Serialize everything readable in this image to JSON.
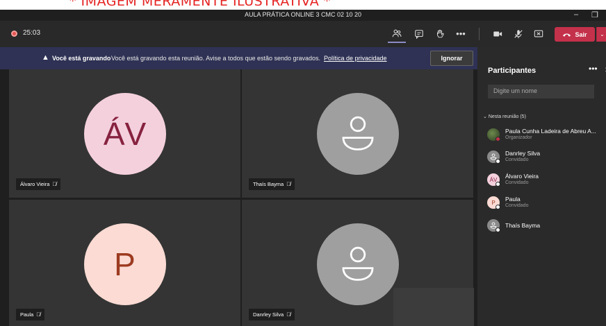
{
  "banner": {
    "text": "* IMAGEM MERAMENTE ILUSTRATIVA *"
  },
  "window": {
    "title": "AULA PRÁTICA ONLINE 3 CMC 02 10 20"
  },
  "toolbar": {
    "timer": "25:03",
    "leave_label": "Sair"
  },
  "recording_notice": {
    "bold": "Você está gravando",
    "message": "Você está gravando esta reunião. Avise a todos que estão sendo gravados.",
    "link": "Política de privacidade",
    "ignore_label": "Ignorar"
  },
  "tiles": [
    {
      "name": "Álvaro Vieira",
      "initials": "ÁV",
      "avatar_bg": "#f4d0dd",
      "avatar_fg": "#86223f"
    },
    {
      "name": "Thaís Bayma",
      "initials": "",
      "avatar_bg": "#9f9f9f",
      "avatar_fg": "#ffffff"
    },
    {
      "name": "Paula",
      "initials": "P",
      "avatar_bg": "#fbdbd4",
      "avatar_fg": "#9c3b21"
    },
    {
      "name": "Danrley Silva",
      "initials": "",
      "avatar_bg": "#9f9f9f",
      "avatar_fg": "#ffffff"
    }
  ],
  "panel": {
    "title": "Participantes",
    "search_placeholder": "Digite um nome",
    "section": "Nesta reunião (5)",
    "participants": [
      {
        "name": "Paula Cunha Ladeira de Abreu A...",
        "role": "Organizador",
        "initials": "",
        "status": "red"
      },
      {
        "name": "Danrley Silva",
        "role": "Convidado",
        "initials": "",
        "status": "white"
      },
      {
        "name": "Álvaro Vieira",
        "role": "Convidado",
        "initials": "ÁV",
        "status": "white"
      },
      {
        "name": "Paula",
        "role": "Convidado",
        "initials": "P",
        "status": "white"
      },
      {
        "name": "Thaís Bayma",
        "role": "",
        "initials": "",
        "status": "white"
      }
    ]
  },
  "colors": {
    "accent": "#8b8cc7",
    "leave": "#c4314b",
    "notice_bg": "#2f3254"
  }
}
